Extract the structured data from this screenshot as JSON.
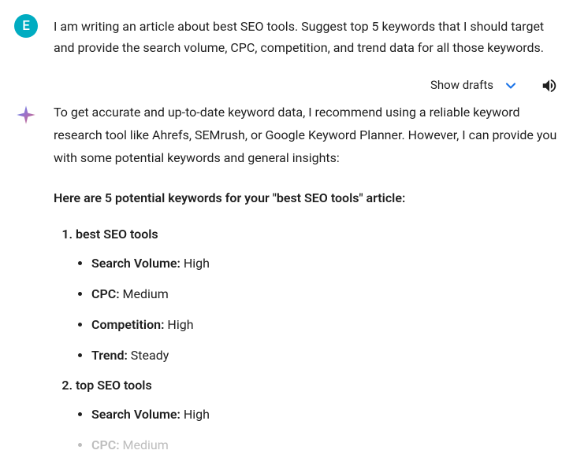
{
  "user": {
    "avatar_letter": "E",
    "prompt": "I am writing an article about best SEO tools. Suggest top 5 keywords that I should target and provide the search volume, CPC, competition, and trend data for all those keywords."
  },
  "controls": {
    "show_drafts_label": "Show drafts"
  },
  "ai": {
    "intro": "To get accurate and up-to-date keyword data, I recommend using a reliable keyword research tool like Ahrefs, SEMrush, or Google Keyword Planner. However, I can provide you with some potential keywords and general insights:",
    "heading": "Here are 5 potential keywords for your \"best SEO tools\" article:",
    "keywords": [
      {
        "title": "best SEO tools",
        "attrs": [
          {
            "label": "Search Volume:",
            "value": " High",
            "fade": false
          },
          {
            "label": "CPC:",
            "value": " Medium",
            "fade": false
          },
          {
            "label": "Competition:",
            "value": " High",
            "fade": false
          },
          {
            "label": "Trend:",
            "value": " Steady",
            "fade": false
          }
        ]
      },
      {
        "title": "top SEO tools",
        "attrs": [
          {
            "label": "Search Volume:",
            "value": " High",
            "fade": false
          },
          {
            "label": "CPC:",
            "value": " Medium",
            "fade": true
          }
        ]
      }
    ]
  }
}
